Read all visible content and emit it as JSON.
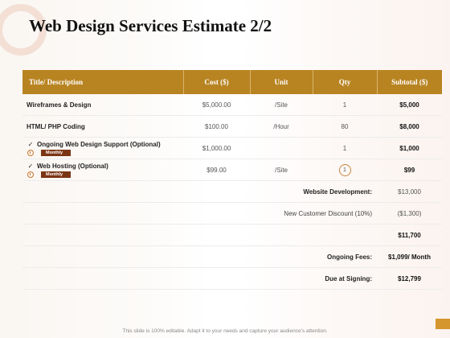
{
  "title": "Web Design Services Estimate 2/2",
  "table": {
    "headers": [
      "Title/ Description",
      "Cost ($)",
      "Unit",
      "Qty",
      "Subtotal ($)"
    ],
    "rows": [
      {
        "desc": "Wireframes & Design",
        "cost": "$5,000.00",
        "unit": "/Site",
        "qty": "1",
        "subtotal": "$5,000"
      },
      {
        "desc": "HTML/ PHP Coding",
        "cost": "$100.00",
        "unit": "/Hour",
        "qty": "80",
        "subtotal": "$8,000"
      },
      {
        "desc": "Ongoing Web Design Support (Optional)",
        "badge": "Monthly",
        "cost": "$1,000.00",
        "unit": "",
        "qty": "1",
        "subtotal": "$1,000"
      },
      {
        "desc": "Web Hosting (Optional)",
        "badge": "Monthly",
        "cost": "$99.00",
        "unit": "/Site",
        "qty": "1",
        "subtotal": "$99"
      }
    ],
    "summary": {
      "website_development_label": "Website Development:",
      "website_development_value": "$13,000",
      "discount_label": "New Customer Discount (10%)",
      "discount_value": "($1,300)",
      "total_value": "$11,700",
      "ongoing_fees_label": "Ongoing Fees:",
      "ongoing_fees_value": "$1,099/ Month",
      "due_label": "Due at Signing:",
      "due_value": "$12,799"
    }
  },
  "footer": "This slide is 100% editable. Adapt it to your needs and capture your audience's attention.",
  "colors": {
    "header_bg": "#b88422",
    "badge_bg": "#7c3514",
    "accent": "#d6962e"
  }
}
